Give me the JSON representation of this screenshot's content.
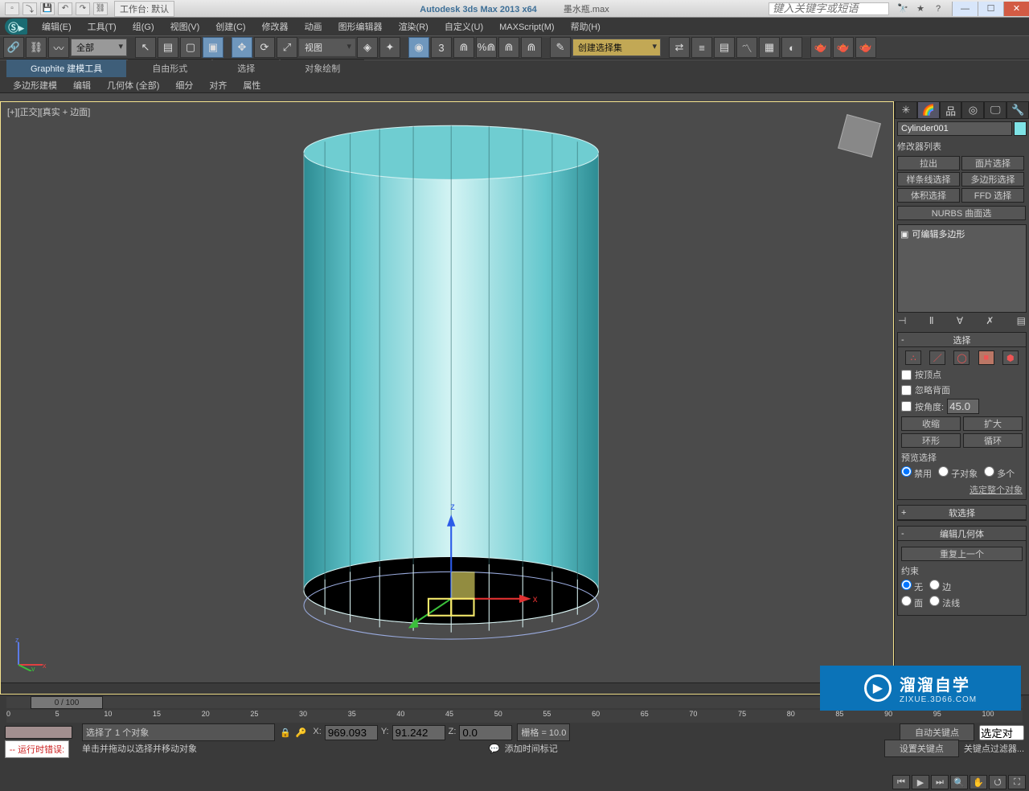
{
  "titlebar": {
    "workspace": "工作台: 默认",
    "app_title": "Autodesk 3ds Max  2013 x64",
    "file_name": "墨水瓶.max",
    "search_placeholder": "键入关键字或短语"
  },
  "menubar": {
    "items": [
      "编辑(E)",
      "工具(T)",
      "组(G)",
      "视图(V)",
      "创建(C)",
      "修改器",
      "动画",
      "图形编辑器",
      "渲染(R)",
      "自定义(U)",
      "MAXScript(M)",
      "帮助(H)"
    ]
  },
  "toolbar": {
    "filter_all": "全部",
    "view_label": "视图",
    "named_sel": "创建选择集"
  },
  "ribbon": {
    "tabs": [
      "Graphite 建模工具",
      "自由形式",
      "选择",
      "对象绘制"
    ],
    "subtabs": [
      "多边形建模",
      "编辑",
      "几何体 (全部)",
      "细分",
      "对齐",
      "属性"
    ]
  },
  "viewport": {
    "label": "[+][正交][真实 + 边面]",
    "axis_z": "z",
    "axis_x": "x",
    "axis_y": "y"
  },
  "cmd": {
    "object_name": "Cylinder001",
    "mod_list": "修改器列表",
    "mod_btns": [
      "拉出",
      "面片选择",
      "样条线选择",
      "多边形选择",
      "体积选择",
      "FFD 选择"
    ],
    "nurbs_btn": "NURBS 曲面选",
    "stack_item": "可编辑多边形",
    "rollout_select": "选择",
    "chk_byvertex": "按顶点",
    "chk_ignoreback": "忽略背面",
    "chk_byangle": "按角度:",
    "angle_val": "45.0",
    "btn_shrink": "收缩",
    "btn_grow": "扩大",
    "btn_ring": "环形",
    "btn_loop": "循环",
    "preview_sel": "预览选择",
    "rad_none": "禁用",
    "rad_sub": "子对象",
    "rad_multi": "多个",
    "select_whole": "选定整个对象",
    "rollout_soft": "软选择",
    "rollout_editgeom": "编辑几何体",
    "repeat_last": "重复上一个",
    "constraint": "约束",
    "c_none": "无",
    "c_edge": "边",
    "c_face": "面",
    "c_normal": "法线"
  },
  "timeline": {
    "slider": "0 / 100",
    "ticks": [
      0,
      5,
      10,
      15,
      20,
      25,
      30,
      35,
      40,
      45,
      50,
      55,
      60,
      65,
      70,
      75,
      80,
      85,
      90,
      95,
      100
    ]
  },
  "status": {
    "selected_msg": "选择了 1 个对象",
    "prompt_msg": "单击并拖动以选择并移动对象",
    "x_val": "969.093",
    "y_val": "91.242",
    "z_val": "0.0",
    "grid": "栅格 = 10.0",
    "auto_key": "自动关键点",
    "set_key": "设置关键点",
    "sel_field": "选定对",
    "key_filter": "关键点过滤器...",
    "add_time_tag": "添加时间标记",
    "runtime_error": "-- 运行时错误:"
  },
  "watermark": {
    "big": "溜溜自学",
    "small": "ZIXUE.3D66.COM"
  }
}
